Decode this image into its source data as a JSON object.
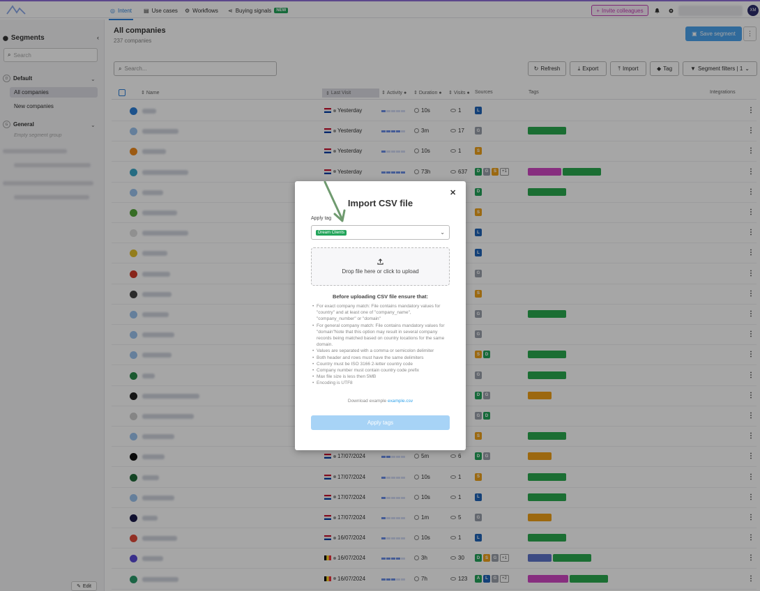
{
  "topbar": {
    "tabs": [
      {
        "label": "Intent",
        "icon": "target-icon",
        "active": true
      },
      {
        "label": "Use cases",
        "icon": "document-icon"
      },
      {
        "label": "Workflows",
        "icon": "workflow-icon"
      },
      {
        "label": "Buying signals",
        "icon": "share-icon",
        "badge": "NEW"
      }
    ],
    "invite_label": "Invite colleagues",
    "avatar_initials": "XM"
  },
  "sidebar": {
    "title": "Segments",
    "search_placeholder": "Search",
    "groups": [
      {
        "name": "Default",
        "badge": "D",
        "items": [
          "All companies",
          "New companies"
        ]
      },
      {
        "name": "General",
        "badge": "G",
        "empty_text": "Empty segment group"
      }
    ],
    "edit_label": "Edit"
  },
  "main": {
    "title": "All companies",
    "subtitle": "237 companies",
    "save_segment_label": "Save segment",
    "search_placeholder": "Search...",
    "toolbar": {
      "refresh": "Refresh",
      "export": "Export",
      "import": "Import",
      "tag": "Tag",
      "segment_filters": "Segment filters | 1"
    },
    "columns": {
      "name": "Name",
      "last_visit": "Last Visit",
      "activity": "Activity",
      "duration": "Duration",
      "visits": "Visits",
      "sources": "Sources",
      "tags": "Tags",
      "integrations": "Integrations"
    },
    "rows": [
      {
        "logo": "#2b7fd8",
        "nw": 20,
        "flag": "nl",
        "lv": "Yesterday",
        "act": 1,
        "dur": "10s",
        "visits": "1",
        "src": [
          "L"
        ],
        "tags": []
      },
      {
        "logo": "#9cc4ee",
        "nw": 52,
        "flag": "nl",
        "lv": "Yesterday",
        "act": 4,
        "dur": "3m",
        "visits": "17",
        "src": [
          "G"
        ],
        "tags": [
          [
            "ni",
            55
          ]
        ]
      },
      {
        "logo": "#f08a1c",
        "nw": 34,
        "flag": "nl",
        "lv": "Yesterday",
        "act": 1,
        "dur": "10s",
        "visits": "1",
        "src": [
          "S"
        ],
        "tags": []
      },
      {
        "logo": "#3aa7c8",
        "nw": 66,
        "flag": "nl",
        "lv": "Yesterday",
        "act": 5,
        "dur": "73h",
        "visits": "637",
        "src": [
          "D",
          "G",
          "S"
        ],
        "more": "+1",
        "tags": [
          [
            "mc",
            48
          ],
          [
            "ni",
            55
          ]
        ]
      },
      {
        "logo": "#9cc4ee",
        "nw": 30,
        "flag": "",
        "lv": "",
        "act": 0,
        "dur": "",
        "visits": "",
        "src": [
          "D"
        ],
        "tags": [
          [
            "ni",
            55
          ]
        ]
      },
      {
        "logo": "#53a83a",
        "nw": 50,
        "flag": "",
        "lv": "",
        "act": 0,
        "dur": "",
        "visits": "",
        "src": [
          "S"
        ],
        "tags": []
      },
      {
        "logo": "#dddddd",
        "nw": 66,
        "flag": "",
        "lv": "",
        "act": 0,
        "dur": "",
        "visits": "",
        "src": [
          "L"
        ],
        "tags": []
      },
      {
        "logo": "#e2c02a",
        "nw": 36,
        "flag": "",
        "lv": "",
        "act": 0,
        "dur": "",
        "visits": "",
        "src": [
          "L"
        ],
        "tags": []
      },
      {
        "logo": "#d23a2a",
        "nw": 40,
        "flag": "",
        "lv": "",
        "act": 0,
        "dur": "",
        "visits": "",
        "src": [
          "G"
        ],
        "tags": []
      },
      {
        "logo": "#444444",
        "nw": 42,
        "flag": "",
        "lv": "",
        "act": 0,
        "dur": "",
        "visits": "",
        "src": [
          "S"
        ],
        "tags": []
      },
      {
        "logo": "#9cc4ee",
        "nw": 38,
        "flag": "",
        "lv": "",
        "act": 0,
        "dur": "",
        "visits": "",
        "src": [
          "G"
        ],
        "tags": [
          [
            "ni",
            55
          ]
        ]
      },
      {
        "logo": "#9cc4ee",
        "nw": 46,
        "flag": "",
        "lv": "",
        "act": 0,
        "dur": "",
        "visits": "",
        "src": [
          "G"
        ],
        "tags": []
      },
      {
        "logo": "#9cc4ee",
        "nw": 42,
        "flag": "",
        "lv": "",
        "act": 0,
        "dur": "",
        "visits": "",
        "src": [
          "S",
          "D"
        ],
        "tags": [
          [
            "ni",
            55
          ]
        ]
      },
      {
        "logo": "#2a8a4a",
        "nw": 18,
        "flag": "",
        "lv": "",
        "act": 0,
        "dur": "",
        "visits": "",
        "src": [
          "G"
        ],
        "tags": [
          [
            "ni",
            55
          ]
        ]
      },
      {
        "logo": "#222222",
        "nw": 82,
        "flag": "",
        "lv": "",
        "act": 0,
        "dur": "",
        "visits": "",
        "src": [
          "D",
          "G"
        ],
        "tags": [
          [
            "pr",
            34
          ]
        ]
      },
      {
        "logo": "#cccccc",
        "nw": 74,
        "flag": "",
        "lv": "",
        "act": 0,
        "dur": "",
        "visits": "",
        "src": [
          "G",
          "D"
        ],
        "tags": []
      },
      {
        "logo": "#9cc4ee",
        "nw": 46,
        "flag": "",
        "lv": "",
        "act": 0,
        "dur": "",
        "visits": "",
        "src": [
          "S"
        ],
        "tags": [
          [
            "ni",
            55
          ]
        ]
      },
      {
        "logo": "#111111",
        "nw": 32,
        "flag": "nl",
        "lv": "17/07/2024",
        "act": 2,
        "dur": "5m",
        "visits": "6",
        "src": [
          "D",
          "G"
        ],
        "tags": [
          [
            "pr",
            34
          ]
        ]
      },
      {
        "logo": "#1f6a3a",
        "nw": 24,
        "flag": "nl",
        "lv": "17/07/2024",
        "act": 1,
        "dur": "10s",
        "visits": "1",
        "src": [
          "S"
        ],
        "tags": [
          [
            "ni",
            55
          ]
        ]
      },
      {
        "logo": "#9cc4ee",
        "nw": 46,
        "flag": "nl",
        "lv": "17/07/2024",
        "act": 1,
        "dur": "10s",
        "visits": "1",
        "src": [
          "L"
        ],
        "tags": [
          [
            "ni",
            55
          ]
        ]
      },
      {
        "logo": "#1a1a4a",
        "nw": 22,
        "flag": "nl",
        "lv": "17/07/2024",
        "act": 1,
        "dur": "1m",
        "visits": "5",
        "src": [
          "G"
        ],
        "tags": [
          [
            "pr",
            34
          ]
        ]
      },
      {
        "logo": "#e04a3a",
        "nw": 50,
        "flag": "nl",
        "lv": "16/07/2024",
        "act": 1,
        "dur": "10s",
        "visits": "1",
        "src": [
          "L"
        ],
        "tags": [
          [
            "ni",
            55
          ]
        ]
      },
      {
        "logo": "#5a4ad6",
        "nw": 30,
        "flag": "be",
        "lv": "16/07/2024",
        "act": 4,
        "dur": "3h",
        "visits": "30",
        "src": [
          "D",
          "S",
          "G"
        ],
        "more": "+1",
        "tags": [
          [
            "sp",
            34
          ],
          [
            "ni",
            55
          ]
        ]
      },
      {
        "logo": "#2a9a6a",
        "nw": 52,
        "flag": "be",
        "lv": "16/07/2024",
        "act": 3,
        "dur": "7h",
        "visits": "123",
        "src": [
          "A",
          "L",
          "G"
        ],
        "more": "+2",
        "tags": [
          [
            "ip",
            58
          ],
          [
            "ni",
            55
          ]
        ]
      }
    ]
  },
  "modal": {
    "title": "Import CSV file",
    "apply_tag_label": "Apply tag",
    "selected_tag": "Dream Clients",
    "drop_text": "Drop file here or click to upload",
    "before_title": "Before uploading CSV file ensure that:",
    "rules": [
      "For exact company match: File contains mandatory values for \"country\" and at least one of \"company_name\", \"company_number\" or \"domain\"",
      "For general company match: File contains mandatory values for \"domain\"Note that this option may result in several company records being matched based on country locations for the same domain.",
      "Values are separated with a comma or semicolon delimiter",
      "Both header and rows must have the same delimiters",
      "Country must be ISO 3166 2-letter country code",
      "Company number must contain country code prefix",
      "Max file size is less then 5MB",
      "Encoding is UTF8"
    ],
    "download_prefix": "Download example",
    "download_link": "example.csv",
    "apply_button": "Apply tags"
  },
  "colors": {
    "accent": "#2b7fd8",
    "annotation_arrow": "#6f9a6f",
    "tag_green": "#22a45a"
  }
}
